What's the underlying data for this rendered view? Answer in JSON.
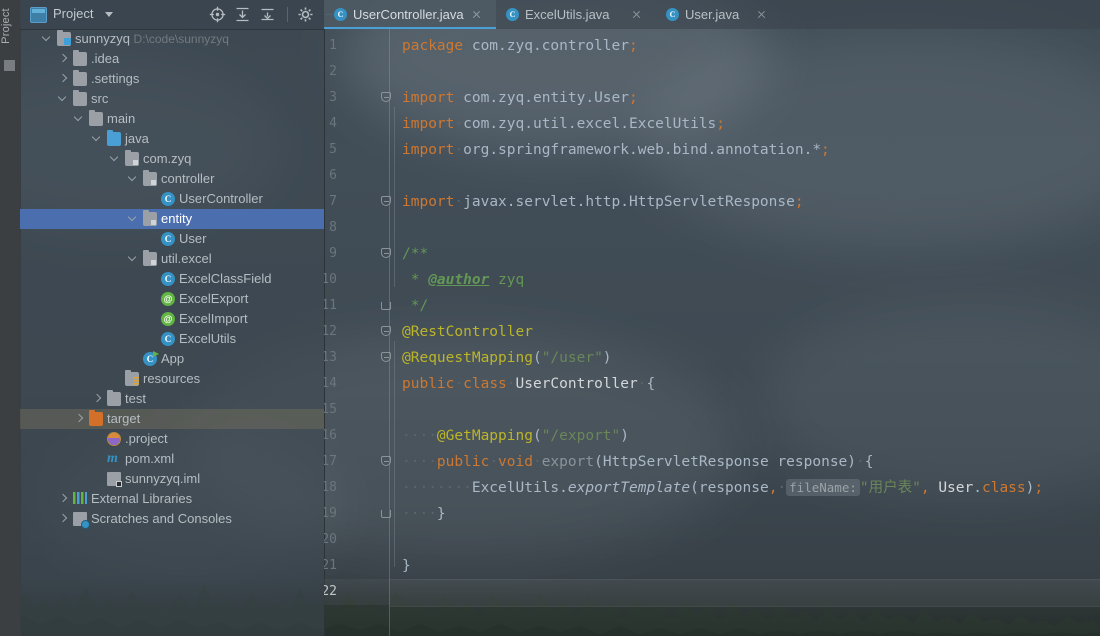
{
  "toolwindow_stripe": {
    "label": "Project"
  },
  "project_panel": {
    "title": "Project",
    "icons": [
      "project-view-icon",
      "chevron-down-icon",
      "locate-icon",
      "expand-all-icon",
      "collapse-all-icon",
      "settings-gear-icon",
      "hide-icon"
    ],
    "tree": [
      {
        "label": "sunnyzyq",
        "sub": "D:\\code\\sunnyzyq",
        "depth": 0,
        "icon": "module-folder-icon",
        "arrow": "open",
        "state": "normal"
      },
      {
        "label": ".idea",
        "sub": "",
        "depth": 1,
        "icon": "folder-icon",
        "arrow": "closed",
        "state": "normal"
      },
      {
        "label": ".settings",
        "sub": "",
        "depth": 1,
        "icon": "folder-icon",
        "arrow": "closed",
        "state": "normal"
      },
      {
        "label": "src",
        "sub": "",
        "depth": 1,
        "icon": "folder-icon",
        "arrow": "open",
        "state": "normal"
      },
      {
        "label": "main",
        "sub": "",
        "depth": 2,
        "icon": "folder-icon",
        "arrow": "open",
        "state": "normal"
      },
      {
        "label": "java",
        "sub": "",
        "depth": 3,
        "icon": "source-folder-icon",
        "arrow": "open",
        "state": "normal"
      },
      {
        "label": "com.zyq",
        "sub": "",
        "depth": 4,
        "icon": "package-icon",
        "arrow": "open",
        "state": "normal"
      },
      {
        "label": "controller",
        "sub": "",
        "depth": 5,
        "icon": "package-icon",
        "arrow": "open",
        "state": "normal"
      },
      {
        "label": "UserController",
        "sub": "",
        "depth": 6,
        "icon": "java-class-icon",
        "arrow": "none",
        "state": "normal"
      },
      {
        "label": "entity",
        "sub": "",
        "depth": 5,
        "icon": "package-icon",
        "arrow": "open",
        "state": "selected"
      },
      {
        "label": "User",
        "sub": "",
        "depth": 6,
        "icon": "java-class-icon",
        "arrow": "none",
        "state": "normal"
      },
      {
        "label": "util.excel",
        "sub": "",
        "depth": 5,
        "icon": "package-icon",
        "arrow": "open",
        "state": "normal"
      },
      {
        "label": "ExcelClassField",
        "sub": "",
        "depth": 6,
        "icon": "java-class-icon",
        "arrow": "none",
        "state": "normal"
      },
      {
        "label": "ExcelExport",
        "sub": "",
        "depth": 6,
        "icon": "java-annotation-icon",
        "arrow": "none",
        "state": "normal"
      },
      {
        "label": "ExcelImport",
        "sub": "",
        "depth": 6,
        "icon": "java-annotation-icon",
        "arrow": "none",
        "state": "normal"
      },
      {
        "label": "ExcelUtils",
        "sub": "",
        "depth": 6,
        "icon": "java-class-icon",
        "arrow": "none",
        "state": "normal"
      },
      {
        "label": "App",
        "sub": "",
        "depth": 5,
        "icon": "runnable-class-icon",
        "arrow": "none",
        "state": "normal"
      },
      {
        "label": "resources",
        "sub": "",
        "depth": 4,
        "icon": "resources-folder-icon",
        "arrow": "none",
        "state": "normal"
      },
      {
        "label": "test",
        "sub": "",
        "depth": 3,
        "icon": "folder-icon",
        "arrow": "closed",
        "state": "normal"
      },
      {
        "label": "target",
        "sub": "",
        "depth": 2,
        "icon": "excluded-folder-icon",
        "arrow": "closed",
        "state": "hover"
      },
      {
        "label": ".project",
        "sub": "",
        "depth": 3,
        "icon": "eclipse-project-file-icon",
        "arrow": "none",
        "state": "normal"
      },
      {
        "label": "pom.xml",
        "sub": "",
        "depth": 3,
        "icon": "maven-pom-icon",
        "arrow": "none",
        "state": "normal"
      },
      {
        "label": "sunnyzyq.iml",
        "sub": "",
        "depth": 3,
        "icon": "iml-module-file-icon",
        "arrow": "none",
        "state": "normal"
      },
      {
        "label": "External Libraries",
        "sub": "",
        "depth": 1,
        "icon": "external-libraries-icon",
        "arrow": "closed",
        "state": "normal"
      },
      {
        "label": "Scratches and Consoles",
        "sub": "",
        "depth": 1,
        "icon": "scratches-icon",
        "arrow": "closed",
        "state": "normal"
      }
    ]
  },
  "editor": {
    "tabs": [
      {
        "label": "UserController.java",
        "icon": "java-class-icon",
        "active": true
      },
      {
        "label": "ExcelUtils.java",
        "icon": "java-class-icon",
        "active": false
      },
      {
        "label": "User.java",
        "icon": "java-class-icon",
        "active": false
      }
    ],
    "current_line": 22,
    "line_numbers": [
      1,
      2,
      3,
      4,
      5,
      6,
      7,
      8,
      9,
      10,
      11,
      12,
      13,
      14,
      15,
      16,
      17,
      18,
      19,
      20,
      21,
      22
    ],
    "lines": [
      {
        "n": 1,
        "text": "package com.zyq.controller;"
      },
      {
        "n": 2,
        "text": ""
      },
      {
        "n": 3,
        "text": "import com.zyq.entity.User;"
      },
      {
        "n": 4,
        "text": "import com.zyq.util.excel.ExcelUtils;"
      },
      {
        "n": 5,
        "text": "import org.springframework.web.bind.annotation.*;"
      },
      {
        "n": 6,
        "text": ""
      },
      {
        "n": 7,
        "text": "import javax.servlet.http.HttpServletResponse;"
      },
      {
        "n": 8,
        "text": ""
      },
      {
        "n": 9,
        "text": "/**"
      },
      {
        "n": 10,
        "text": " * @author zyq"
      },
      {
        "n": 11,
        "text": " */"
      },
      {
        "n": 12,
        "text": "@RestController"
      },
      {
        "n": 13,
        "text": "@RequestMapping(\"/user\")"
      },
      {
        "n": 14,
        "text": "public class UserController {"
      },
      {
        "n": 15,
        "text": ""
      },
      {
        "n": 16,
        "text": "    @GetMapping(\"/export\")"
      },
      {
        "n": 17,
        "text": "    public void export(HttpServletResponse response) {"
      },
      {
        "n": 18,
        "text": "        ExcelUtils.exportTemplate(response, fileName: \"用户表\", User.class);"
      },
      {
        "n": 19,
        "text": "    }"
      },
      {
        "n": 20,
        "text": ""
      },
      {
        "n": 21,
        "text": "}"
      },
      {
        "n": 22,
        "text": ""
      }
    ],
    "parameter_hint": "fileName:"
  },
  "colors": {
    "keyword": "#cc7832",
    "string": "#6a8759",
    "comment": "#629755",
    "annotation": "#bbb529",
    "identifier": "#a9b7c6",
    "selection": "#4b6eaf",
    "tab_accent": "#4a9fd4"
  }
}
